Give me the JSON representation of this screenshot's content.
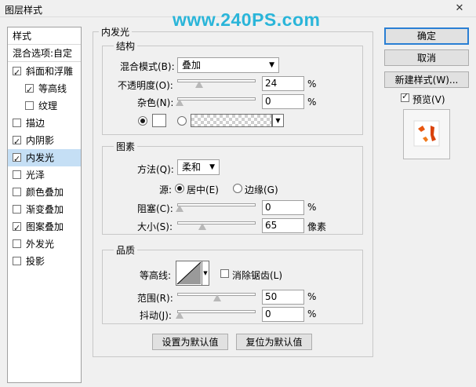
{
  "window": {
    "title": "图层样式",
    "watermark": "www.240PS.com",
    "close_glyph": "✕"
  },
  "left_panel": {
    "header": "样式",
    "blend_options": "混合选项:自定",
    "items": [
      {
        "label": "斜面和浮雕",
        "checked": true
      },
      {
        "label": "等高线",
        "checked": true
      },
      {
        "label": "纹理",
        "checked": false
      },
      {
        "label": "描边",
        "checked": false
      },
      {
        "label": "内阴影",
        "checked": true
      },
      {
        "label": "内发光",
        "checked": true
      },
      {
        "label": "光泽",
        "checked": false
      },
      {
        "label": "颜色叠加",
        "checked": false
      },
      {
        "label": "渐变叠加",
        "checked": false
      },
      {
        "label": "图案叠加",
        "checked": true
      },
      {
        "label": "外发光",
        "checked": false
      },
      {
        "label": "投影",
        "checked": false
      }
    ],
    "selected": "内发光"
  },
  "panel_title": "内发光",
  "structure": {
    "title": "结构",
    "blend_mode_label": "混合模式(B):",
    "blend_mode_value": "叠加",
    "opacity_label": "不透明度(O):",
    "opacity_value": "24",
    "noise_label": "杂色(N):",
    "noise_value": "0",
    "percent": "%"
  },
  "elements": {
    "title": "图素",
    "method_label": "方法(Q):",
    "method_value": "柔和",
    "source_label": "源:",
    "source_center": "居中(E)",
    "source_edge": "边缘(G)",
    "choke_label": "阻塞(C):",
    "choke_value": "0",
    "size_label": "大小(S):",
    "size_value": "65",
    "pixels": "像素",
    "percent": "%"
  },
  "quality": {
    "title": "品质",
    "contour_label": "等高线:",
    "antialias_label": "消除锯齿(L)",
    "range_label": "范围(R):",
    "range_value": "50",
    "jitter_label": "抖动(J):",
    "jitter_value": "0",
    "percent": "%"
  },
  "bottom_buttons": {
    "set_default": "设置为默认值",
    "reset_default": "复位为默认值"
  },
  "right_buttons": {
    "ok": "确定",
    "cancel": "取消",
    "new_style": "新建样式(W)...",
    "preview_label": "预览(V)"
  },
  "colors": {
    "accent": "#2a7fd4",
    "selection": "#c5dff5",
    "watermark": "#2ab5d9"
  }
}
